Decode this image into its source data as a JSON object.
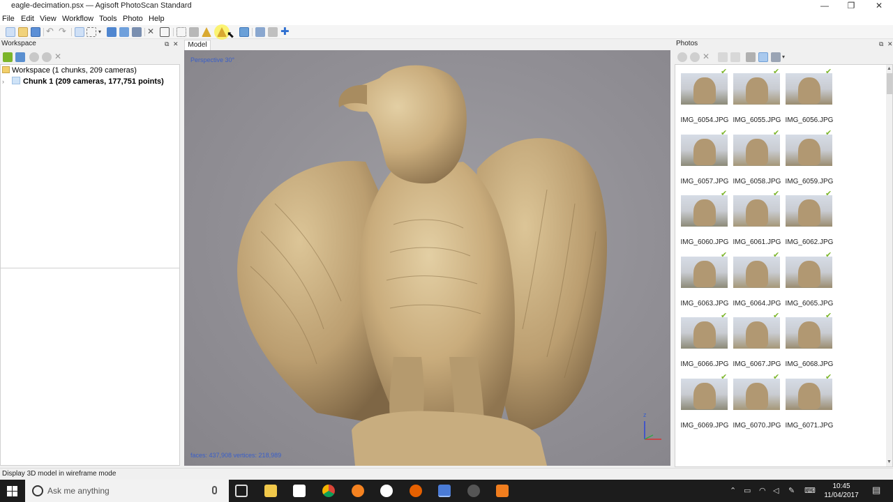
{
  "window": {
    "title": "eagle-decimation.psx — Agisoft PhotoScan Standard",
    "minimize": "—",
    "maximize": "❐",
    "close": "✕"
  },
  "menu": [
    "File",
    "Edit",
    "View",
    "Workflow",
    "Tools",
    "Photo",
    "Help"
  ],
  "workspace": {
    "title": "Workspace",
    "root_label": "Workspace (1 chunks, 209 cameras)",
    "chunk_label": "Chunk 1 (209 cameras, 177,751 points)"
  },
  "model": {
    "tab": "Model",
    "projection": "Perspective 30°",
    "stats": "faces: 437,908 vertices: 218,989",
    "axis_label": "z"
  },
  "photos": {
    "title": "Photos",
    "items": [
      "IMG_6054.JPG",
      "IMG_6055.JPG",
      "IMG_6056.JPG",
      "IMG_6057.JPG",
      "IMG_6058.JPG",
      "IMG_6059.JPG",
      "IMG_6060.JPG",
      "IMG_6061.JPG",
      "IMG_6062.JPG",
      "IMG_6063.JPG",
      "IMG_6064.JPG",
      "IMG_6065.JPG",
      "IMG_6066.JPG",
      "IMG_6067.JPG",
      "IMG_6068.JPG",
      "IMG_6069.JPG",
      "IMG_6070.JPG",
      "IMG_6071.JPG"
    ]
  },
  "status": "Display 3D model in wireframe mode",
  "taskbar": {
    "search_placeholder": "Ask me anything",
    "time": "10:45",
    "date": "11/04/2017"
  },
  "colors": {
    "accent": "#3a5fc8",
    "check": "#7cb52a",
    "model": "#c9ac7c"
  }
}
